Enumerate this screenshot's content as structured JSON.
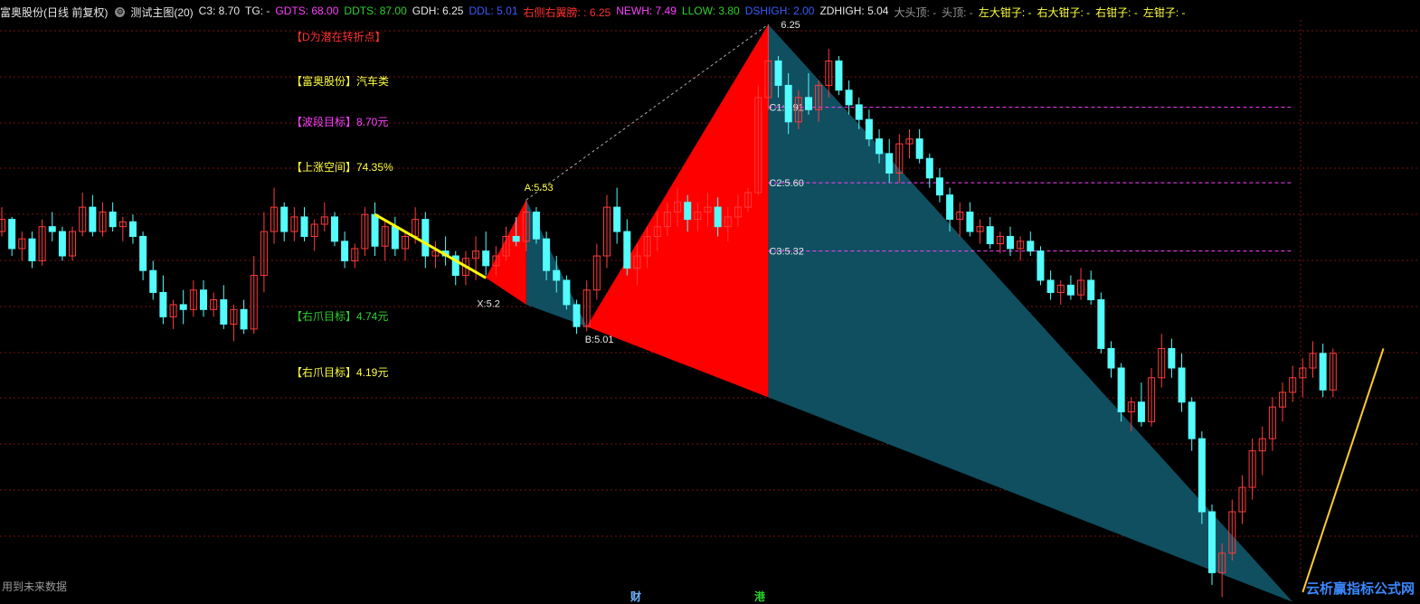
{
  "header": {
    "stock_title": "富奥股份(日线 前复权)",
    "indicator_name": "测试主图(20)",
    "fields": [
      {
        "label": "C3: 8.70",
        "color": "#e8e8e8"
      },
      {
        "label": "TG: -",
        "color": "#e8e8e8"
      },
      {
        "label": "GDTS: 68.00",
        "color": "#ff40ff"
      },
      {
        "label": "DDTS: 87.00",
        "color": "#2dd12d"
      },
      {
        "label": "GDH: 6.25",
        "color": "#e8e8e8"
      },
      {
        "label": "DDL: 5.01",
        "color": "#3a5bff"
      },
      {
        "label": "右侧右翼膀: : 6.25",
        "color": "#ff3030"
      },
      {
        "label": "NEWH: 7.49",
        "color": "#ff40ff"
      },
      {
        "label": "LLOW: 3.80",
        "color": "#2dd12d"
      },
      {
        "label": "DSHIGH: 2.00",
        "color": "#3a5bff"
      },
      {
        "label": "ZDHIGH: 5.04",
        "color": "#e8e8e8"
      },
      {
        "label": "大头顶: -",
        "color": "#9a9a9a"
      },
      {
        "label": "头顶: -",
        "color": "#9a9a9a"
      },
      {
        "label": "左大钳子: -",
        "color": "#ffff40"
      },
      {
        "label": "右大钳子: -",
        "color": "#ffff40"
      },
      {
        "label": "右钳子: -",
        "color": "#ffff40"
      },
      {
        "label": "左钳子: -",
        "color": "#ffff40"
      }
    ]
  },
  "side_labels": [
    {
      "text": "【D为潜在转折点】",
      "color": "#ff3030"
    },
    {
      "text": "【富奥股份】汽车类",
      "color": "#ffff40"
    },
    {
      "text": "【波段目标】8.70元",
      "color": "#ff40ff"
    },
    {
      "text": "【上涨空间】74.35%",
      "color": "#ffff40"
    },
    {
      "text": "【右爪目标】4.74元",
      "color": "#2dd12d"
    },
    {
      "text": "【右爪目标】4.19元",
      "color": "#ffff40"
    }
  ],
  "footer": {
    "note": "用到未来数据",
    "marker_1": "财",
    "marker_2": "港",
    "watermark": "云析赢指标公式网"
  },
  "chart_data": {
    "type": "candlestick",
    "colors": {
      "up": "#ff3b3b",
      "down": "#54fcfc",
      "fill_red": "#ff0000",
      "fill_teal": "#0f4f60",
      "trend": "#ffff00",
      "level_line": "#ff40ff",
      "grid": "#7a1010"
    },
    "grid": true,
    "pattern_points": [
      {
        "label": "X:5.2",
        "value": 5.2
      },
      {
        "label": "A:5.53",
        "value": 5.53
      },
      {
        "label": "B:5.01",
        "value": 5.01
      },
      {
        "label": "6.25",
        "value": 6.25
      }
    ],
    "levels": [
      {
        "label": "C1:5.91",
        "value": 5.91
      },
      {
        "label": "C2:5.60",
        "value": 5.6
      },
      {
        "label": "C3:5.32",
        "value": 5.32
      }
    ],
    "candles": [
      [
        5.4,
        5.5,
        5.38,
        5.45
      ],
      [
        5.45,
        5.46,
        5.3,
        5.33
      ],
      [
        5.33,
        5.4,
        5.28,
        5.37
      ],
      [
        5.37,
        5.4,
        5.25,
        5.28
      ],
      [
        5.28,
        5.45,
        5.26,
        5.42
      ],
      [
        5.42,
        5.48,
        5.36,
        5.4
      ],
      [
        5.4,
        5.42,
        5.28,
        5.3
      ],
      [
        5.3,
        5.42,
        5.28,
        5.4
      ],
      [
        5.4,
        5.56,
        5.38,
        5.5
      ],
      [
        5.5,
        5.55,
        5.38,
        5.4
      ],
      [
        5.4,
        5.52,
        5.38,
        5.48
      ],
      [
        5.48,
        5.52,
        5.4,
        5.42
      ],
      [
        5.42,
        5.46,
        5.36,
        5.44
      ],
      [
        5.44,
        5.47,
        5.35,
        5.38
      ],
      [
        5.38,
        5.4,
        5.2,
        5.24
      ],
      [
        5.24,
        5.28,
        5.12,
        5.15
      ],
      [
        5.15,
        5.22,
        5.02,
        5.05
      ],
      [
        5.05,
        5.12,
        5.0,
        5.1
      ],
      [
        5.1,
        5.16,
        5.02,
        5.08
      ],
      [
        5.08,
        5.2,
        5.05,
        5.16
      ],
      [
        5.16,
        5.2,
        5.05,
        5.08
      ],
      [
        5.08,
        5.15,
        5.05,
        5.12
      ],
      [
        5.12,
        5.18,
        5.0,
        5.02
      ],
      [
        5.02,
        5.1,
        4.95,
        5.08
      ],
      [
        5.08,
        5.12,
        4.98,
        5.0
      ],
      [
        5.0,
        5.3,
        4.98,
        5.22
      ],
      [
        5.22,
        5.48,
        5.15,
        5.4
      ],
      [
        5.4,
        5.58,
        5.35,
        5.5
      ],
      [
        5.5,
        5.52,
        5.36,
        5.4
      ],
      [
        5.4,
        5.5,
        5.36,
        5.46
      ],
      [
        5.46,
        5.5,
        5.36,
        5.38
      ],
      [
        5.38,
        5.45,
        5.32,
        5.43
      ],
      [
        5.43,
        5.52,
        5.4,
        5.46
      ],
      [
        5.46,
        5.48,
        5.34,
        5.36
      ],
      [
        5.36,
        5.4,
        5.25,
        5.28
      ],
      [
        5.28,
        5.35,
        5.25,
        5.33
      ],
      [
        5.33,
        5.5,
        5.3,
        5.47
      ],
      [
        5.47,
        5.52,
        5.3,
        5.34
      ],
      [
        5.34,
        5.45,
        5.28,
        5.42
      ],
      [
        5.42,
        5.46,
        5.3,
        5.33
      ],
      [
        5.33,
        5.4,
        5.28,
        5.38
      ],
      [
        5.38,
        5.5,
        5.35,
        5.45
      ],
      [
        5.45,
        5.48,
        5.25,
        5.3
      ],
      [
        5.3,
        5.36,
        5.25,
        5.32
      ],
      [
        5.32,
        5.38,
        5.26,
        5.3
      ],
      [
        5.3,
        5.32,
        5.18,
        5.22
      ],
      [
        5.22,
        5.32,
        5.18,
        5.29
      ],
      [
        5.29,
        5.38,
        5.2,
        5.32
      ],
      [
        5.32,
        5.4,
        5.22,
        5.26
      ],
      [
        5.26,
        5.34,
        5.22,
        5.3
      ],
      [
        5.3,
        5.42,
        5.28,
        5.38
      ],
      [
        5.38,
        5.46,
        5.34,
        5.36
      ],
      [
        5.36,
        5.53,
        5.32,
        5.48
      ],
      [
        5.48,
        5.5,
        5.35,
        5.37
      ],
      [
        5.37,
        5.4,
        5.2,
        5.24
      ],
      [
        5.24,
        5.3,
        5.15,
        5.2
      ],
      [
        5.2,
        5.22,
        5.08,
        5.1
      ],
      [
        5.1,
        5.12,
        4.98,
        5.01
      ],
      [
        5.01,
        5.2,
        4.99,
        5.16
      ],
      [
        5.16,
        5.35,
        5.12,
        5.3
      ],
      [
        5.3,
        5.55,
        5.25,
        5.5
      ],
      [
        5.5,
        5.58,
        5.35,
        5.4
      ],
      [
        5.4,
        5.45,
        5.22,
        5.25
      ],
      [
        5.25,
        5.35,
        5.18,
        5.3
      ],
      [
        5.3,
        5.42,
        5.25,
        5.38
      ],
      [
        5.38,
        5.48,
        5.32,
        5.42
      ],
      [
        5.42,
        5.52,
        5.38,
        5.48
      ],
      [
        5.48,
        5.58,
        5.42,
        5.52
      ],
      [
        5.52,
        5.55,
        5.4,
        5.45
      ],
      [
        5.45,
        5.52,
        5.4,
        5.48
      ],
      [
        5.48,
        5.56,
        5.42,
        5.5
      ],
      [
        5.5,
        5.54,
        5.38,
        5.42
      ],
      [
        5.42,
        5.5,
        5.36,
        5.46
      ],
      [
        5.46,
        5.55,
        5.42,
        5.5
      ],
      [
        5.5,
        5.58,
        5.48,
        5.56
      ],
      [
        5.56,
        6.0,
        5.55,
        5.95
      ],
      [
        5.95,
        6.25,
        5.9,
        6.1
      ],
      [
        6.1,
        6.12,
        5.95,
        6.0
      ],
      [
        6.0,
        6.05,
        5.8,
        5.85
      ],
      [
        5.85,
        5.98,
        5.82,
        5.95
      ],
      [
        5.95,
        6.05,
        5.88,
        5.9
      ],
      [
        5.9,
        6.02,
        5.85,
        6.0
      ],
      [
        6.0,
        6.15,
        5.95,
        6.1
      ],
      [
        6.1,
        6.12,
        5.96,
        5.98
      ],
      [
        5.98,
        6.02,
        5.88,
        5.92
      ],
      [
        5.92,
        5.95,
        5.82,
        5.86
      ],
      [
        5.86,
        5.9,
        5.75,
        5.78
      ],
      [
        5.78,
        5.82,
        5.68,
        5.72
      ],
      [
        5.72,
        5.78,
        5.6,
        5.64
      ],
      [
        5.64,
        5.8,
        5.6,
        5.76
      ],
      [
        5.76,
        5.82,
        5.7,
        5.78
      ],
      [
        5.78,
        5.82,
        5.68,
        5.7
      ],
      [
        5.7,
        5.72,
        5.58,
        5.62
      ],
      [
        5.62,
        5.66,
        5.52,
        5.55
      ],
      [
        5.55,
        5.58,
        5.4,
        5.45
      ],
      [
        5.45,
        5.52,
        5.38,
        5.48
      ],
      [
        5.48,
        5.52,
        5.38,
        5.4
      ],
      [
        5.4,
        5.45,
        5.35,
        5.42
      ],
      [
        5.42,
        5.46,
        5.33,
        5.35
      ],
      [
        5.35,
        5.4,
        5.31,
        5.38
      ],
      [
        5.38,
        5.42,
        5.3,
        5.33
      ],
      [
        5.33,
        5.38,
        5.28,
        5.36
      ],
      [
        5.36,
        5.4,
        5.3,
        5.32
      ],
      [
        5.32,
        5.34,
        5.18,
        5.2
      ],
      [
        5.2,
        5.24,
        5.12,
        5.15
      ],
      [
        5.15,
        5.2,
        5.1,
        5.18
      ],
      [
        5.18,
        5.22,
        5.12,
        5.14
      ],
      [
        5.14,
        5.25,
        5.12,
        5.2
      ],
      [
        5.2,
        5.24,
        5.1,
        5.12
      ],
      [
        5.12,
        5.15,
        4.9,
        4.92
      ],
      [
        4.92,
        4.95,
        4.8,
        4.84
      ],
      [
        4.84,
        4.86,
        4.62,
        4.66
      ],
      [
        4.66,
        4.72,
        4.58,
        4.7
      ],
      [
        4.7,
        4.78,
        4.6,
        4.62
      ],
      [
        4.62,
        4.84,
        4.6,
        4.8
      ],
      [
        4.8,
        4.98,
        4.76,
        4.92
      ],
      [
        4.92,
        4.96,
        4.8,
        4.84
      ],
      [
        4.84,
        4.9,
        4.66,
        4.7
      ],
      [
        4.7,
        4.72,
        4.5,
        4.55
      ],
      [
        4.55,
        4.58,
        4.2,
        4.25
      ],
      [
        4.25,
        4.28,
        3.95,
        4.0
      ],
      [
        4.0,
        4.12,
        3.9,
        4.08
      ],
      [
        4.08,
        4.3,
        4.05,
        4.25
      ],
      [
        4.25,
        4.4,
        4.2,
        4.35
      ],
      [
        4.35,
        4.55,
        4.3,
        4.5
      ],
      [
        4.5,
        4.6,
        4.4,
        4.55
      ],
      [
        4.55,
        4.72,
        4.5,
        4.68
      ],
      [
        4.68,
        4.78,
        4.62,
        4.74
      ],
      [
        4.74,
        4.85,
        4.7,
        4.8
      ],
      [
        4.8,
        4.88,
        4.72,
        4.84
      ],
      [
        4.84,
        4.95,
        4.8,
        4.9
      ],
      [
        4.9,
        4.94,
        4.72,
        4.75
      ],
      [
        4.75,
        4.92,
        4.72,
        4.9
      ]
    ]
  }
}
